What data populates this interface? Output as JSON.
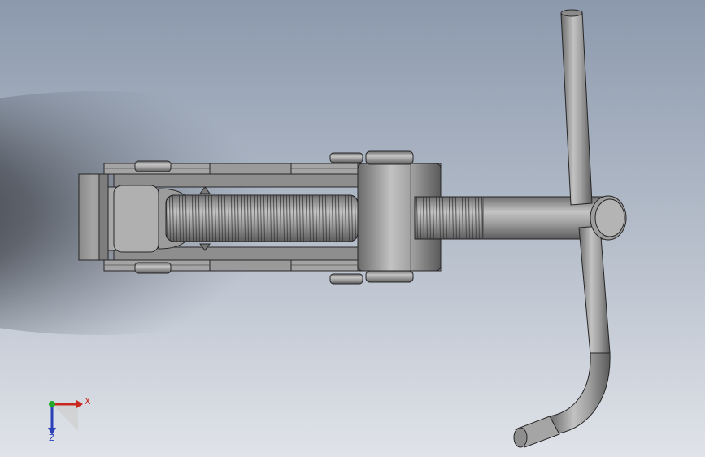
{
  "viewport": {
    "background_top": "#8d9aae",
    "background_bottom": "#dfe2e8",
    "part_color": "#9a9a9a",
    "edge_color": "#262626"
  },
  "triad": {
    "x_label": "X",
    "z_label": "Z",
    "x_color": "#c8281e",
    "y_color": "#22a82a",
    "z_color": "#2a3fb8"
  }
}
